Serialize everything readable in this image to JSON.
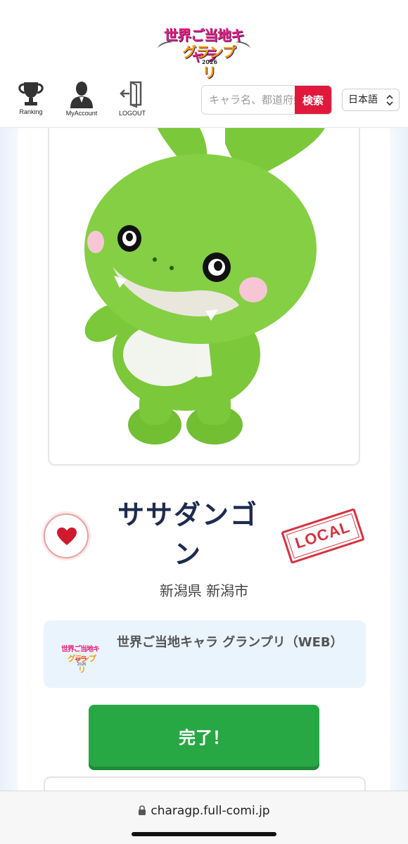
{
  "header": {
    "logo": {
      "line1": "世界ご当地キャラ",
      "line2": "グランプリ",
      "year": "2026"
    },
    "nav": [
      {
        "label": "Ranking",
        "icon": "trophy-icon"
      },
      {
        "label": "MyAccount",
        "icon": "user-icon"
      },
      {
        "label": "LOGOUT",
        "icon": "logout-icon"
      }
    ],
    "search": {
      "placeholder": "キャラ名、都道府県",
      "button_label": "検索"
    },
    "language": {
      "selected": "日本語",
      "arrow": "⌃⌄"
    }
  },
  "character": {
    "name": "ササダンゴン",
    "location": "新潟県 新潟市",
    "badge": "LOCAL",
    "favorite_icon": "heart-icon"
  },
  "event": {
    "logo_line1": "世界ご当地キャラ",
    "logo_line2": "グランプリ",
    "logo_year": "2026",
    "title": "世界ご当地キャラ グランプリ（WEB）"
  },
  "actions": {
    "done_label": "完了！"
  },
  "browser": {
    "url": "charagp.full-comi.jp"
  },
  "colors": {
    "accent_red": "#e0193c",
    "done_green": "#28a745",
    "name_navy": "#1d2b4f",
    "event_bg": "#eaf4fd",
    "stamp_red": "#d6323f",
    "mascot_green": "#7bc83a"
  }
}
